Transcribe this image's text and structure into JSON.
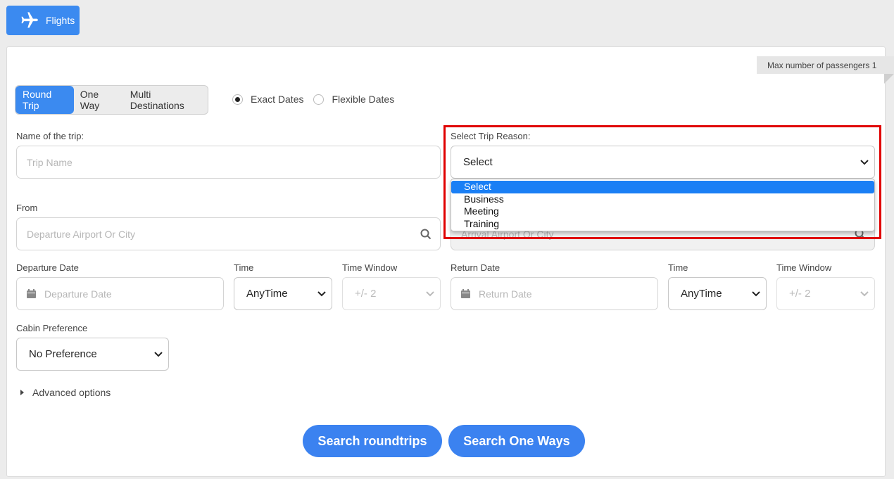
{
  "header": {
    "flights_label": "Flights"
  },
  "max_passengers": "Max number of passengers 1",
  "trip_types": [
    "Round Trip",
    "One Way",
    "Multi Destinations"
  ],
  "date_modes": [
    "Exact Dates",
    "Flexible Dates"
  ],
  "trip_name": {
    "label": "Name of the trip:",
    "placeholder": "Trip Name"
  },
  "trip_reason": {
    "label": "Select Trip Reason:",
    "value": "Select",
    "options": [
      "Select",
      "Business",
      "Meeting",
      "Training"
    ]
  },
  "from": {
    "label": "From",
    "placeholder": "Departure Airport Or City"
  },
  "to": {
    "placeholder": "Arrival Airport Or City"
  },
  "departure": {
    "label": "Departure Date",
    "placeholder": "Departure Date",
    "time_label": "Time",
    "time_value": "AnyTime",
    "window_label": "Time Window",
    "window_value": "+/- 2"
  },
  "return": {
    "label": "Return Date",
    "placeholder": "Return Date",
    "time_label": "Time",
    "time_value": "AnyTime",
    "window_label": "Time Window",
    "window_value": "+/- 2"
  },
  "cabin": {
    "label": "Cabin Preference",
    "value": "No Preference"
  },
  "advanced_label": "Advanced options",
  "buttons": {
    "roundtrips": "Search roundtrips",
    "oneways": "Search One Ways"
  },
  "colors": {
    "accent": "#3b8af0",
    "highlight": "#e00000",
    "option_selected": "#1a7ff5"
  }
}
